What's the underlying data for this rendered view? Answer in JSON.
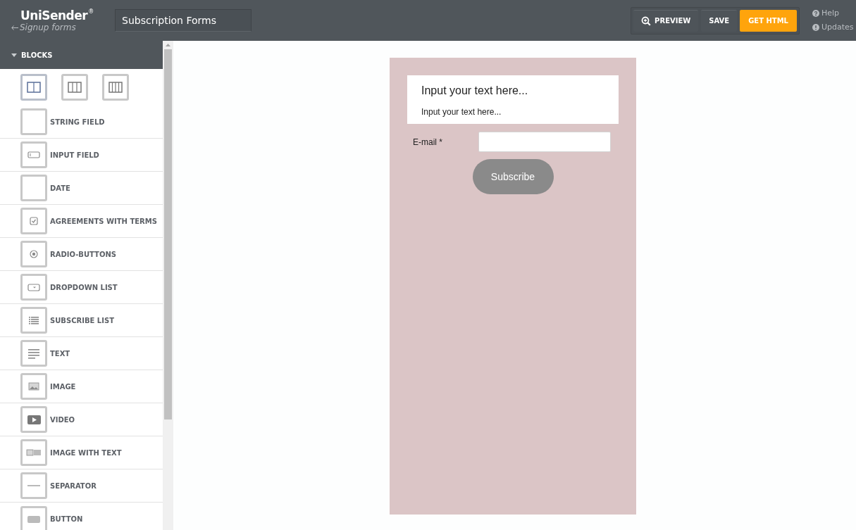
{
  "header": {
    "logo": "UniSender",
    "logo_mark": "®",
    "back_link": "Signup forms",
    "form_name": "Subscription Forms",
    "buttons": [
      {
        "label": "PREVIEW",
        "kind": "preview"
      },
      {
        "label": "SAVE",
        "kind": "save"
      },
      {
        "label": "GET HTML",
        "kind": "primary"
      }
    ],
    "links": [
      {
        "label": "Help",
        "kind": "help"
      },
      {
        "label": "Updates",
        "kind": "updates"
      }
    ]
  },
  "sidebar": {
    "title": "BLOCKS",
    "expanded": true,
    "layouts": [
      {
        "kind": "two",
        "selected": true
      },
      {
        "kind": "three",
        "selected": false
      },
      {
        "kind": "four",
        "selected": false
      }
    ],
    "blocks": [
      {
        "label": "STRING FIELD",
        "kind": "blank"
      },
      {
        "label": "INPUT FIELD",
        "kind": "input"
      },
      {
        "label": "DATE",
        "kind": "blank"
      },
      {
        "label": "AGREEMENTS WITH TERMS",
        "kind": "checkbox"
      },
      {
        "label": "RADIO-BUTTONS",
        "kind": "radio"
      },
      {
        "label": "DROPDOWN LIST",
        "kind": "dropdown"
      },
      {
        "label": "SUBSCRIBE LIST",
        "kind": "list"
      },
      {
        "label": "TEXT",
        "kind": "text"
      },
      {
        "label": "IMAGE",
        "kind": "image"
      },
      {
        "label": "VIDEO",
        "kind": "video"
      },
      {
        "label": "IMAGE WITH TEXT",
        "kind": "imagetext"
      },
      {
        "label": "SEPARATOR",
        "kind": "separator"
      },
      {
        "label": "BUTTON",
        "kind": "button"
      }
    ]
  },
  "form": {
    "heading": "Input your text here...",
    "subtext": "Input your text here...",
    "field_label": "E-mail *",
    "submit": "Subscribe"
  }
}
